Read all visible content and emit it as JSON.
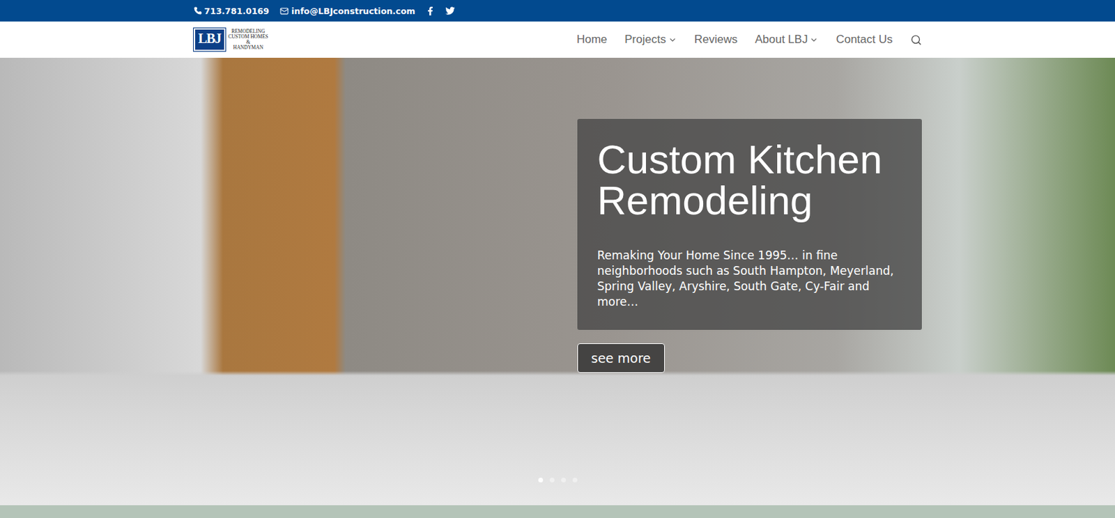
{
  "topbar": {
    "phone": "713.781.0169",
    "email": "info@LBJconstruction.com"
  },
  "logo": {
    "mark": "LBJ",
    "lines": [
      "REMODELING",
      "CUSTOM HOMES",
      "&",
      "HANDYMAN"
    ]
  },
  "nav": [
    {
      "label": "Home",
      "dropdown": false
    },
    {
      "label": "Projects",
      "dropdown": true
    },
    {
      "label": "Reviews",
      "dropdown": false
    },
    {
      "label": "About LBJ",
      "dropdown": true
    },
    {
      "label": "Contact Us",
      "dropdown": false
    }
  ],
  "hero": {
    "title": "Custom Kitchen Remodeling",
    "subtitle": "Remaking Your Home Since 1995… in fine neighborhoods such as South Hampton, Meyerland, Spring Valley, Aryshire, South Gate, Cy-Fair and more…",
    "button": "see more",
    "slides": [
      {
        "selected": true
      },
      {
        "selected": false
      },
      {
        "selected": false
      },
      {
        "selected": false
      }
    ]
  }
}
